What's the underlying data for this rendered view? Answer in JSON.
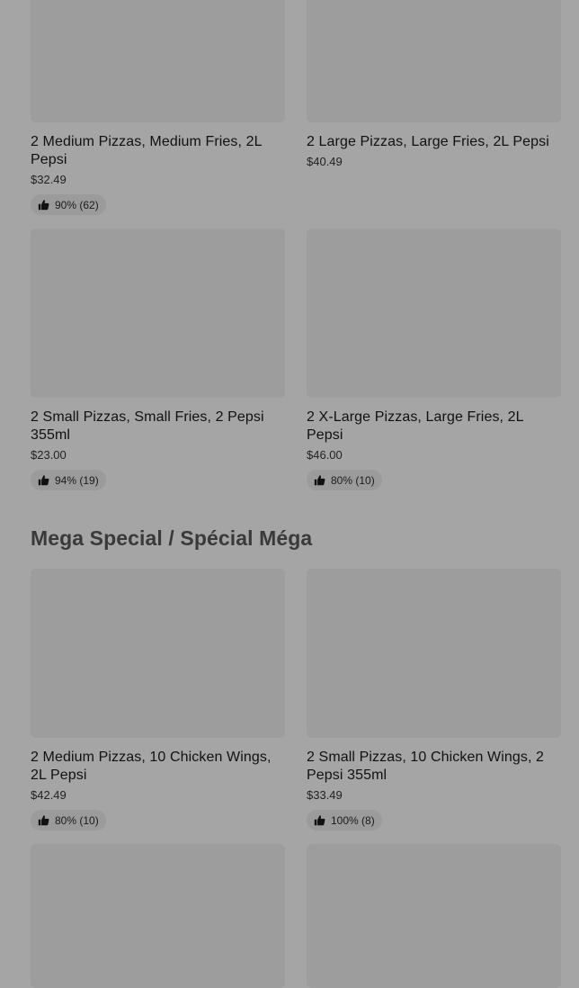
{
  "sections": [
    {
      "title": "",
      "items": [
        {
          "name": "2 Medium Pizzas, Medium Fries, 2L Pepsi",
          "price": "$32.49",
          "rating": "90% (62)"
        },
        {
          "name": "2 Large Pizzas, Large Fries, 2L Pepsi",
          "price": "$40.49",
          "rating": ""
        },
        {
          "name": "2 Small Pizzas, Small Fries, 2 Pepsi 355ml",
          "price": "$23.00",
          "rating": "94% (19)"
        },
        {
          "name": "2 X-Large Pizzas, Large Fries, 2L Pepsi",
          "price": "$46.00",
          "rating": "80% (10)"
        }
      ]
    },
    {
      "title": "Mega Special / Spécial Méga",
      "items": [
        {
          "name": "2 Medium Pizzas, 10 Chicken Wings, 2L Pepsi",
          "price": "$42.49",
          "rating": "80% (10)"
        },
        {
          "name": "2 Small Pizzas, 10 Chicken Wings, 2 Pepsi 355ml",
          "price": "$33.49",
          "rating": "100% (8)"
        }
      ]
    }
  ],
  "icons": {
    "rating": "thumbs-up-icon"
  },
  "colors": {
    "overlay_background": "#a5a5a5",
    "card_image_placeholder": "#9d9d9d",
    "rating_badge": "#9b9b9b"
  }
}
